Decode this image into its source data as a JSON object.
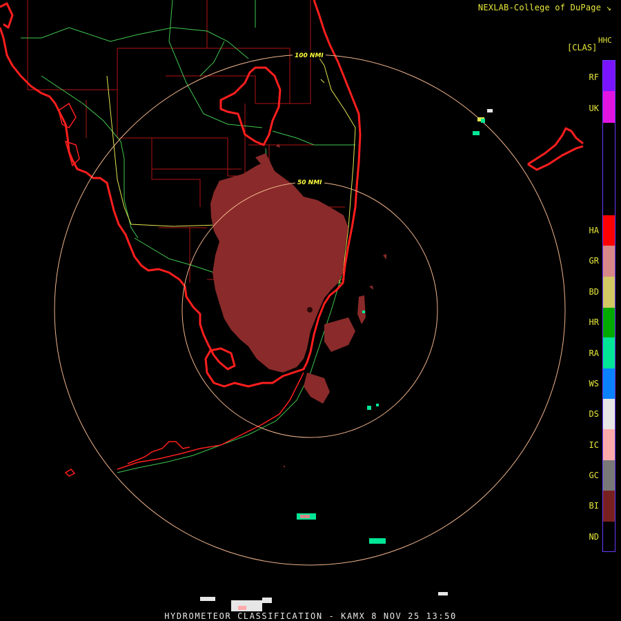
{
  "header": {
    "credit": "NEXLAB-College of DuPage",
    "credit_icon": "diagonal-arrow-icon",
    "product_code": "HHC",
    "legend_title": "[CLAS]"
  },
  "rings": {
    "inner_label": "50 NMI",
    "outer_label": "100 NMI",
    "ring_color": "#f0b48c"
  },
  "legend": [
    {
      "code": "RF",
      "color": "#7a14ff"
    },
    {
      "code": "UK",
      "color": "#e214e2"
    },
    {
      "code": "HA",
      "color": "#ff0000"
    },
    {
      "code": "GR",
      "color": "#d88888"
    },
    {
      "code": "BD",
      "color": "#d2c864"
    },
    {
      "code": "HR",
      "color": "#00aa00"
    },
    {
      "code": "RA",
      "color": "#00e696"
    },
    {
      "code": "WS",
      "color": "#0a82ff"
    },
    {
      "code": "DS",
      "color": "#e6e6e6"
    },
    {
      "code": "IC",
      "color": "#ffaaaa"
    },
    {
      "code": "GC",
      "color": "#787878"
    },
    {
      "code": "BI",
      "color": "#782020"
    },
    {
      "code": "ND",
      "color": "#000000"
    }
  ],
  "footer": {
    "caption": "HYDROMETEOR CLASSIFICATION - KAMX 8 NOV 25 13:50"
  },
  "colors": {
    "coastline": "#ff1e1e",
    "county_lines": "#b41414",
    "highways": "#40c850",
    "interstates": "#e6e650",
    "echo": "#8a2a2a"
  }
}
